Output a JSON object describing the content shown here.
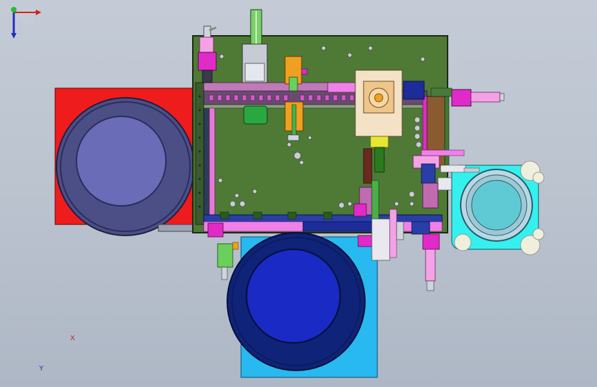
{
  "viewport": {
    "background_top": "#c4cbd6",
    "background_bottom": "#aeb7c5"
  },
  "colors": {
    "base_plate": "#4e7a36",
    "base_plate_edge": "#1a2a12",
    "red_bowl_base": "#ee1c1c",
    "red_bowl_outer": "#4b4f86",
    "red_bowl_inner": "#6a6cb8",
    "blue_bowl_base": "#27b9ef",
    "blue_bowl_outer": "#0f2378",
    "blue_bowl_inner": "#1a2ac4",
    "cyan_bowl_base": "#35f0ee",
    "cyan_bowl_ring": "#b8d8e4",
    "cyan_bowl_inner": "#5fcad4",
    "pink_rail": "#f080e8",
    "magenta": "#e02bc8",
    "orange_slide": "#f0a020",
    "beige_block": "#f4e2c6",
    "yellow_block": "#e9e633",
    "dark_blue": "#1e2c9a",
    "green_guide": "#5fd04c",
    "light_gray": "#b8bfc8"
  },
  "triad": {
    "x_label": "X",
    "y_label": "Y",
    "icon": "coordinate-triad-icon"
  }
}
